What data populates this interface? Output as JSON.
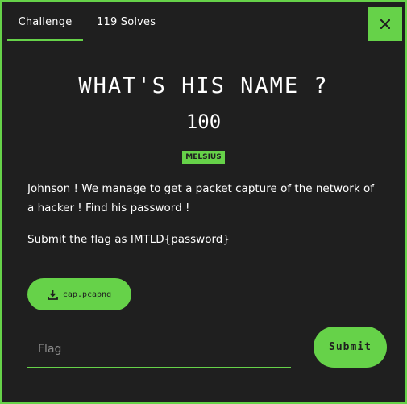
{
  "tabs": [
    {
      "label": "Challenge"
    },
    {
      "label": "119 Solves"
    }
  ],
  "close_icon": "close-icon",
  "challenge": {
    "title": "WHAT'S HIS NAME ?",
    "value": "100",
    "tag": "MELSIUS",
    "description_1": "Johnson ! We manage to get a packet capture of the network of a hacker ! Find his password !",
    "description_2": "Submit the flag as IMTLD{password}"
  },
  "download": {
    "icon": "download-icon",
    "label": "cap.pcapng"
  },
  "flag": {
    "placeholder": "Flag",
    "value": ""
  },
  "submit": {
    "label": "Submit"
  },
  "colors": {
    "accent": "#66d249",
    "background": "#1f1f1f"
  }
}
